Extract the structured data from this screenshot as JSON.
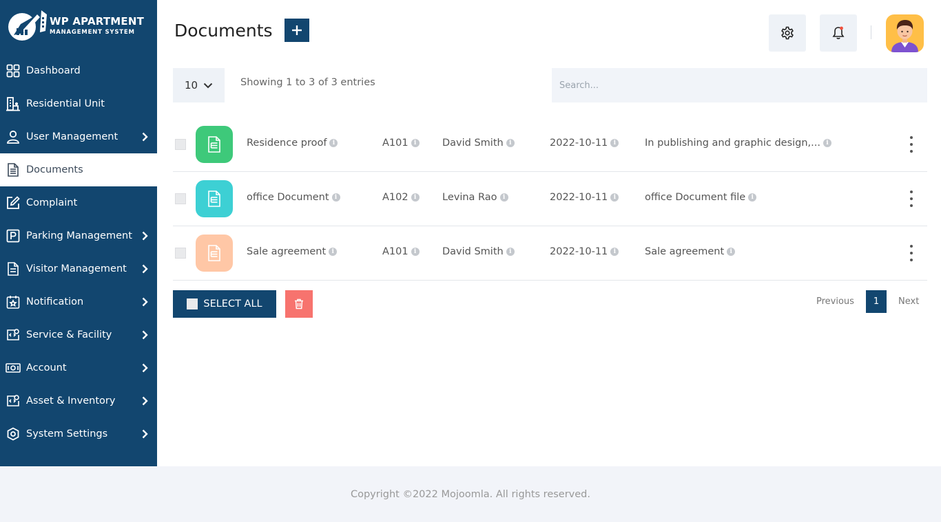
{
  "logo": {
    "title": "WP APARTMENT",
    "subtitle": "MANAGEMENT SYSTEM"
  },
  "sidebar": {
    "items": [
      {
        "label": "Dashboard",
        "icon": "dashboard-grid-icon",
        "has_chevron": false
      },
      {
        "label": "Residential Unit",
        "icon": "building-icon",
        "has_chevron": false
      },
      {
        "label": "User Management",
        "icon": "user-icon",
        "has_chevron": true
      },
      {
        "label": "Documents",
        "icon": "document-icon",
        "has_chevron": false,
        "active": true
      },
      {
        "label": "Complaint",
        "icon": "edit-icon",
        "has_chevron": false
      },
      {
        "label": "Parking Management",
        "icon": "parking-icon",
        "has_chevron": true
      },
      {
        "label": "Visitor Management",
        "icon": "visitor-document-icon",
        "has_chevron": true
      },
      {
        "label": "Notification",
        "icon": "calendar-star-icon",
        "has_chevron": true
      },
      {
        "label": "Service & Facility",
        "icon": "service-icon",
        "has_chevron": true
      },
      {
        "label": "Account",
        "icon": "money-icon",
        "has_chevron": true
      },
      {
        "label": "Asset & Inventory",
        "icon": "asset-icon",
        "has_chevron": true
      },
      {
        "label": "System Settings",
        "icon": "settings-eye-icon",
        "has_chevron": true
      }
    ]
  },
  "header": {
    "title": "Documents"
  },
  "controls": {
    "page_size": "10",
    "showing": "Showing 1 to 3 of 3 entries",
    "search_placeholder": "Search..."
  },
  "rows": [
    {
      "name": "Residence proof",
      "unit": "A101",
      "member": "David Smith",
      "date": "2022-10-11",
      "description": "In publishing and graphic design,...",
      "icon_color": "#3ec97a"
    },
    {
      "name": "office Document",
      "unit": "A102",
      "member": "Levina Rao",
      "date": "2022-10-11",
      "description": "office Document file",
      "icon_color": "#3dd0d4"
    },
    {
      "name": "Sale agreement",
      "unit": "A101",
      "member": "David Smith",
      "date": "2022-10-11",
      "description": "Sale agreement",
      "icon_color": "#ffc7a6"
    }
  ],
  "actions": {
    "select_all": "SELECT ALL"
  },
  "pagination": {
    "previous": "Previous",
    "current": "1",
    "next": "Next"
  },
  "footer": {
    "copyright": "Copyright ©2022 Mojoomla. All rights reserved."
  },
  "colors": {
    "primary": "#12466f",
    "danger": "#f7736e",
    "notification_dot": "#f0503c"
  }
}
